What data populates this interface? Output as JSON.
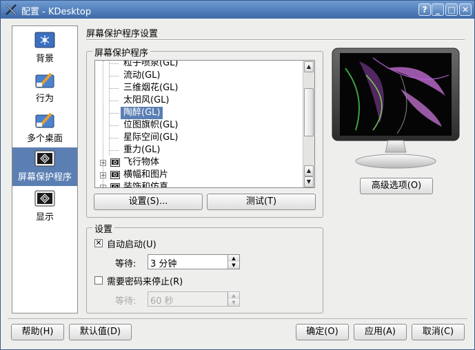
{
  "window": {
    "title": "配置 - KDesktop",
    "help_label": "?",
    "minimize_label": "_",
    "maximize_label": "□",
    "close_label": "✕"
  },
  "sidebar": {
    "items": [
      {
        "label": "背景",
        "icon": "background-icon",
        "selected": false
      },
      {
        "label": "行为",
        "icon": "behavior-icon",
        "selected": false
      },
      {
        "label": "多个桌面",
        "icon": "multiple-desktops-icon",
        "selected": false
      },
      {
        "label": "屏幕保护程序",
        "icon": "screensaver-icon",
        "selected": true
      },
      {
        "label": "显示",
        "icon": "display-icon",
        "selected": false
      }
    ]
  },
  "header": {
    "title": "屏幕保护程序设置"
  },
  "screensaver_group": {
    "label": "屏幕保护程序",
    "tree": {
      "children": [
        "粒子喷泉(GL)",
        "流动(GL)",
        "三维烟花(GL)",
        "太阳风(GL)",
        "陶醉(GL)",
        "位图旗帜(GL)",
        "星际空间(GL)",
        "重力(GL)"
      ],
      "selected": "陶醉(GL)",
      "categories": [
        "飞行物体",
        "横幅和图片",
        "装饰和仿真"
      ]
    },
    "setup_button": "设置(S)...",
    "test_button": "测试(T)"
  },
  "preview": {
    "advanced_button": "高级选项(O)"
  },
  "settings_group": {
    "label": "设置",
    "auto_start_label": "自动启动(U)",
    "auto_start_checked": true,
    "wait_label": "等待:",
    "wait_value": "3 分钟",
    "password_label": "需要密码来停止(R)",
    "password_checked": false,
    "password_wait_label": "等待:",
    "password_wait_value": "60 秒"
  },
  "footer": {
    "help_button": "帮助(H)",
    "defaults_button": "默认值(D)",
    "ok_button": "确定(O)",
    "apply_button": "应用(A)",
    "cancel_button": "取消(C)"
  },
  "colors": {
    "selection": "#5b7fb3",
    "titlebar": "#4f7db8",
    "window_bg": "#eeeeec"
  }
}
